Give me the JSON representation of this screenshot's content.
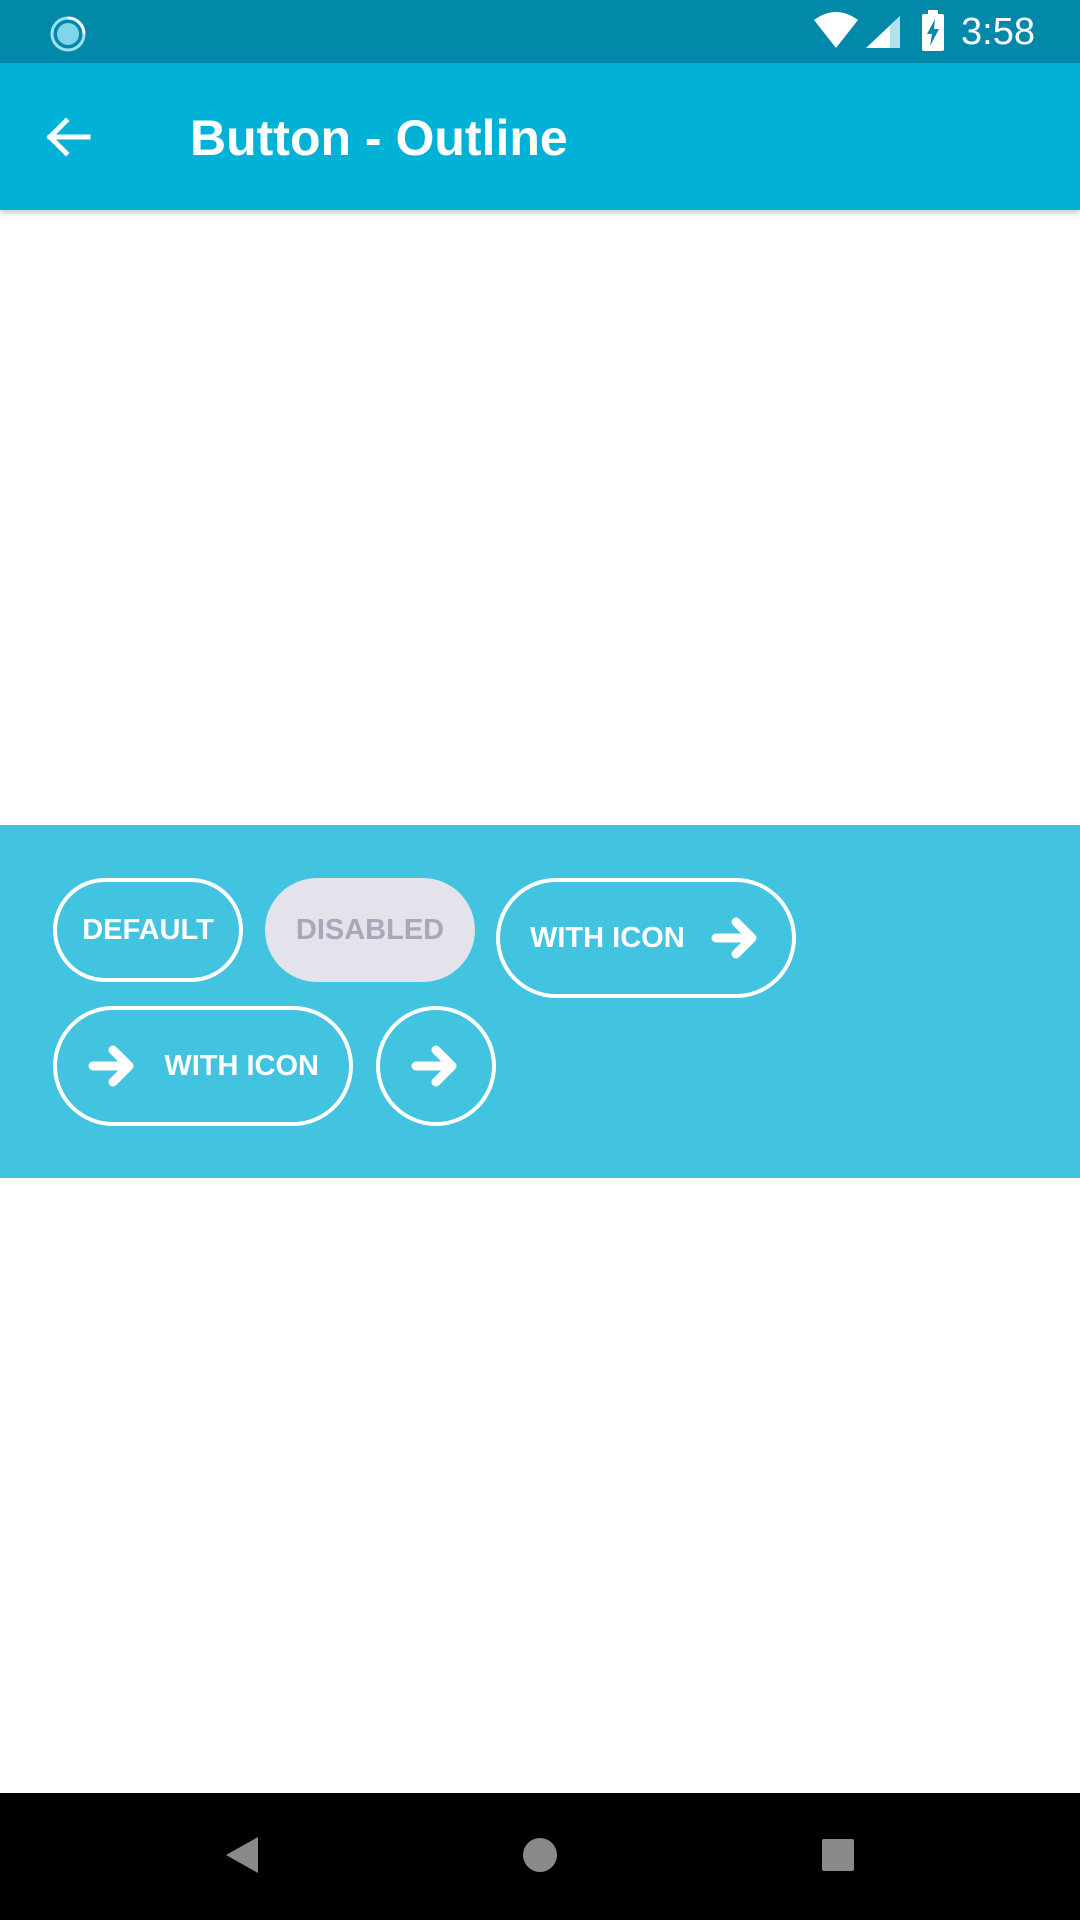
{
  "status_bar": {
    "time": "3:58",
    "left_icon": "sync-circle-icon",
    "icons": [
      "wifi-icon",
      "signal-icon",
      "battery-charging-icon"
    ]
  },
  "app_bar": {
    "title": "Button - Outline",
    "back_icon": "arrow-back-icon"
  },
  "buttons": {
    "default_label": "DEFAULT",
    "disabled_label": "DISABLED",
    "with_icon_right_label": "WITH ICON",
    "with_icon_left_label": "WITH ICON",
    "icon_name": "arrow-right-icon"
  },
  "colors": {
    "status_bar": "#0289a9",
    "app_bar": "#01b2d6",
    "panel": "#42c3e0",
    "disabled_fill": "#e4e2ea",
    "disabled_text": "#aba7ba"
  },
  "nav_bar": {
    "icons": [
      "nav-back-icon",
      "nav-home-icon",
      "nav-recents-icon"
    ]
  }
}
